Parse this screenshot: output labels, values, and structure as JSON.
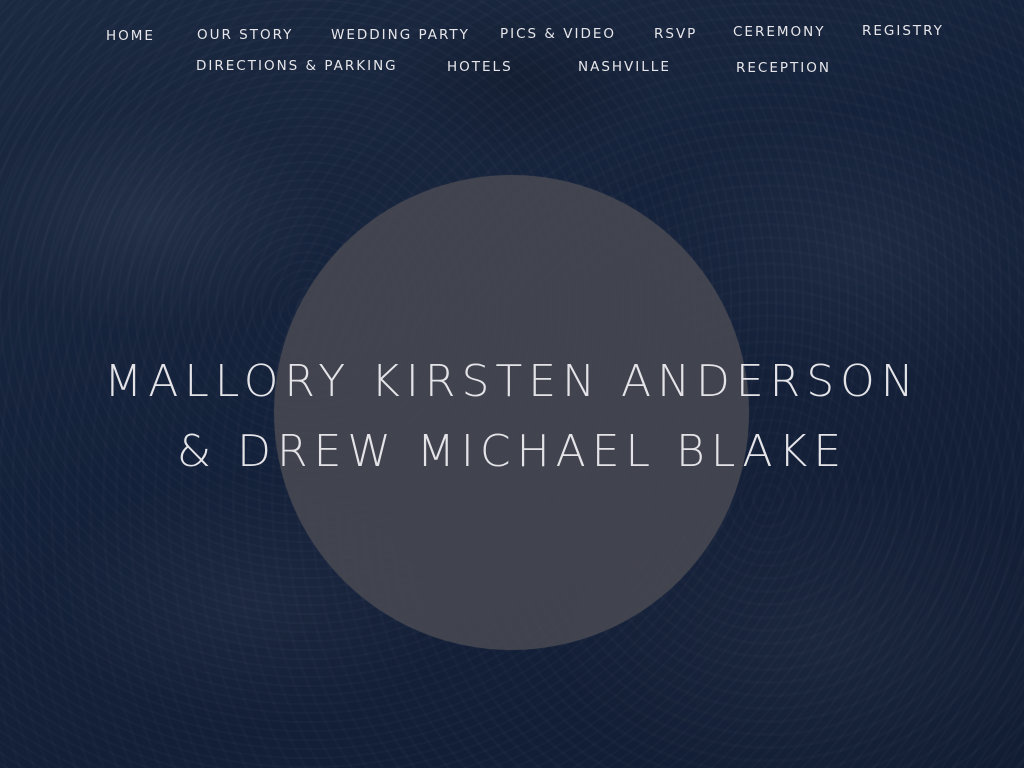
{
  "nav": {
    "home": "HOME",
    "our_story": "OUR STORY",
    "wedding_party": "WEDDING PARTY",
    "pics_video": "PICS & VIDEO",
    "rsvp": "RSVP",
    "ceremony": "CEREMONY",
    "registry": "REGISTRY",
    "directions_parking": "DIRECTIONS & PARKING",
    "hotels": "HOTELS",
    "nashville": "NASHVILLE",
    "reception": "RECEPTION"
  },
  "hero": {
    "line1": "MALLORY KIRSTEN ANDERSON",
    "line2": "& DREW MICHAEL BLAKE"
  },
  "colors": {
    "background": "#162239",
    "circle": "#4a4a52",
    "text": "#e4e4e8"
  }
}
